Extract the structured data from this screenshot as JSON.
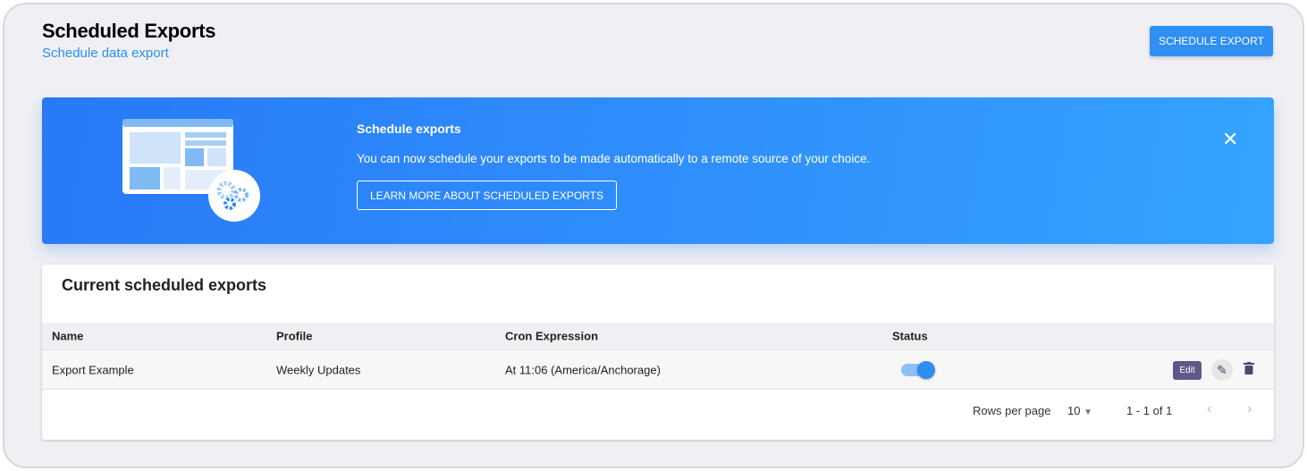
{
  "header": {
    "title": "Scheduled Exports",
    "subtitle": "Schedule data export",
    "schedule_button": "SCHEDULE EXPORT"
  },
  "banner": {
    "title": "Schedule exports",
    "text": "You can now schedule your exports to be made automatically to a remote source of your choice.",
    "learn_more": "LEARN MORE ABOUT SCHEDULED EXPORTS",
    "close_icon": "close-icon"
  },
  "table": {
    "title": "Current scheduled exports",
    "columns": [
      "Name",
      "Profile",
      "Cron Expression",
      "Status"
    ],
    "rows": [
      {
        "name": "Export Example",
        "profile": "Weekly Updates",
        "cron": "At 11:06 (America/Anchorage)",
        "status": true,
        "edit_tooltip": "Edit"
      }
    ]
  },
  "pagination": {
    "rows_per_page_label": "Rows per page",
    "rows_per_page": "10",
    "range": "1 - 1 of 1"
  },
  "colors": {
    "accent": "#2f8ff2",
    "tooltip": "#5f5887"
  }
}
